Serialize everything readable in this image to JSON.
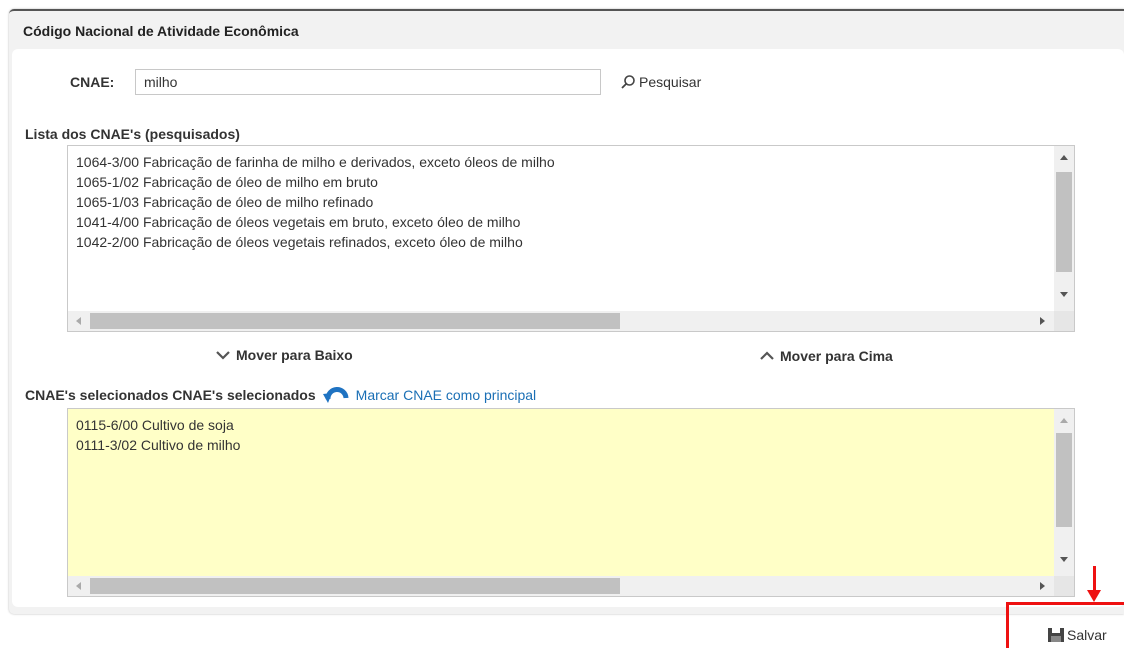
{
  "panel": {
    "title": "Código Nacional de Atividade Econômica"
  },
  "search": {
    "label": "CNAE:",
    "value": "milho",
    "button_label": "Pesquisar"
  },
  "results": {
    "heading": "Lista dos CNAE's (pesquisados)",
    "items": [
      "1064-3/00 Fabricação de farinha de milho e derivados, exceto óleos de milho",
      "1065-1/02 Fabricação de óleo de milho em bruto",
      "1065-1/03 Fabricação de óleo de milho refinado",
      "1041-4/00 Fabricação de óleos vegetais em bruto, exceto óleo de milho",
      "1042-2/00 Fabricação de óleos vegetais refinados, exceto óleo de milho"
    ]
  },
  "move": {
    "down_label": "Mover para Baixo",
    "up_label": "Mover para Cima"
  },
  "selected": {
    "heading": "CNAE's selecionados CNAE's selecionados",
    "mark_principal_label": "Marcar CNAE como principal",
    "items": [
      "0115-6/00 Cultivo de soja",
      "0111-3/02 Cultivo de milho"
    ],
    "background": "#ffffc7"
  },
  "footer": {
    "save_label": "Salvar"
  },
  "colors": {
    "accent": "#1a6fb5",
    "highlight": "#ee1111"
  }
}
